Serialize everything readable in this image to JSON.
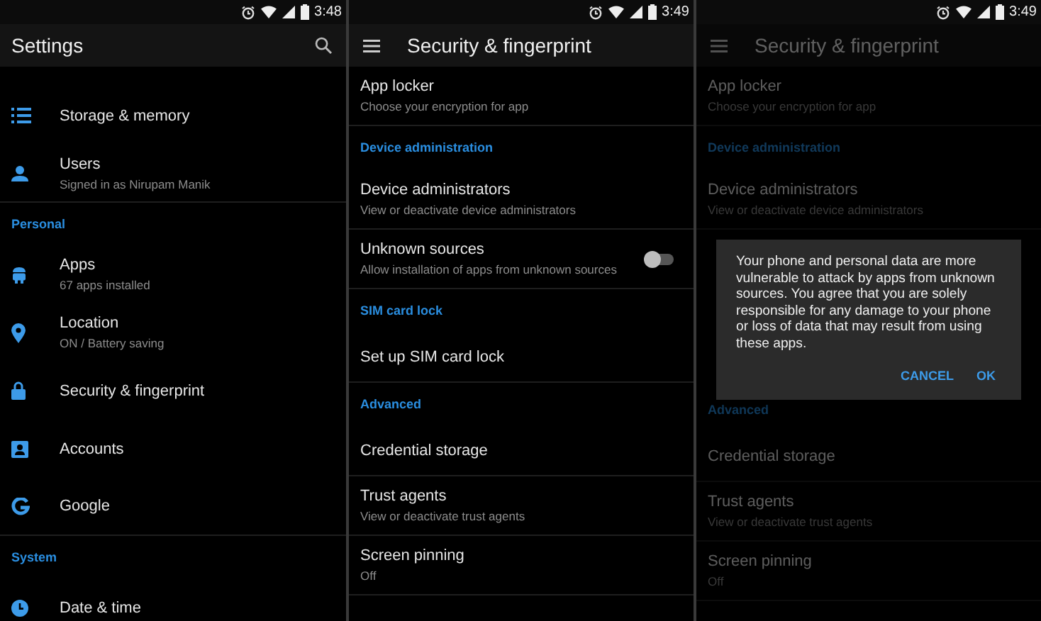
{
  "screens": [
    {
      "status": {
        "time": "3:48"
      },
      "app_bar": {
        "title": "Settings",
        "menu": false,
        "search": true
      },
      "dimmed": false,
      "rows": [
        {
          "kind": "item",
          "title": "Storage & memory",
          "divider": false
        },
        {
          "kind": "item",
          "title": "Users",
          "subtitle": "Signed in as Nirupam Manik",
          "divider": true
        },
        {
          "kind": "header",
          "title": "Personal"
        },
        {
          "kind": "item",
          "title": "Apps",
          "subtitle": "67 apps installed",
          "divider": false
        },
        {
          "kind": "item",
          "title": "Location",
          "subtitle": "ON / Battery saving",
          "divider": false
        },
        {
          "kind": "item",
          "title": "Security & fingerprint",
          "divider": false
        },
        {
          "kind": "item",
          "title": "Accounts",
          "divider": false
        },
        {
          "kind": "item",
          "title": "Google",
          "divider": true
        },
        {
          "kind": "header",
          "title": "System"
        },
        {
          "kind": "item",
          "title": "Date & time",
          "divider": false
        }
      ]
    },
    {
      "status": {
        "time": "3:49"
      },
      "app_bar": {
        "title": "Security & fingerprint",
        "menu": true,
        "search": false
      },
      "dimmed": false,
      "rows": [
        {
          "kind": "item",
          "title": "App locker",
          "subtitle": "Choose your encryption for app",
          "divider": true
        },
        {
          "kind": "header",
          "title": "Device administration"
        },
        {
          "kind": "item",
          "title": "Device administrators",
          "subtitle": "View or deactivate device administrators",
          "divider": true
        },
        {
          "kind": "item",
          "title": "Unknown sources",
          "subtitle": "Allow installation of apps from unknown sources",
          "divider": true,
          "toggle": {
            "on": false
          }
        },
        {
          "kind": "header",
          "title": "SIM card lock"
        },
        {
          "kind": "item",
          "title": "Set up SIM card lock",
          "divider": true
        },
        {
          "kind": "header",
          "title": "Advanced"
        },
        {
          "kind": "item",
          "title": "Credential storage",
          "divider": true
        },
        {
          "kind": "item",
          "title": "Trust agents",
          "subtitle": "View or deactivate trust agents",
          "divider": true
        },
        {
          "kind": "item",
          "title": "Screen pinning",
          "subtitle": "Off",
          "divider": true
        }
      ]
    },
    {
      "status": {
        "time": "3:49"
      },
      "app_bar": {
        "title": "Security & fingerprint",
        "menu": true,
        "search": false
      },
      "dimmed": true,
      "rows": [
        {
          "kind": "item",
          "title": "App locker",
          "subtitle": "Choose your encryption for app",
          "divider": true
        },
        {
          "kind": "header",
          "title": "Device administration"
        },
        {
          "kind": "item",
          "title": "Device administrators",
          "subtitle": "View or deactivate device administrators",
          "divider": true
        },
        {
          "kind": "covered"
        },
        {
          "kind": "header",
          "title": "Advanced"
        },
        {
          "kind": "item",
          "title": "Credential storage",
          "divider": true
        },
        {
          "kind": "item",
          "title": "Trust agents",
          "subtitle": "View or deactivate trust agents",
          "divider": true
        },
        {
          "kind": "item",
          "title": "Screen pinning",
          "subtitle": "Off",
          "divider": true
        }
      ],
      "dialog": {
        "message": "Your phone and personal data are more vulnerable to attack by apps from unknown sources. You agree that you are solely responsible for any damage to your phone or loss of data that may result from using these apps.",
        "buttons": [
          "CANCEL",
          "OK"
        ]
      }
    }
  ]
}
